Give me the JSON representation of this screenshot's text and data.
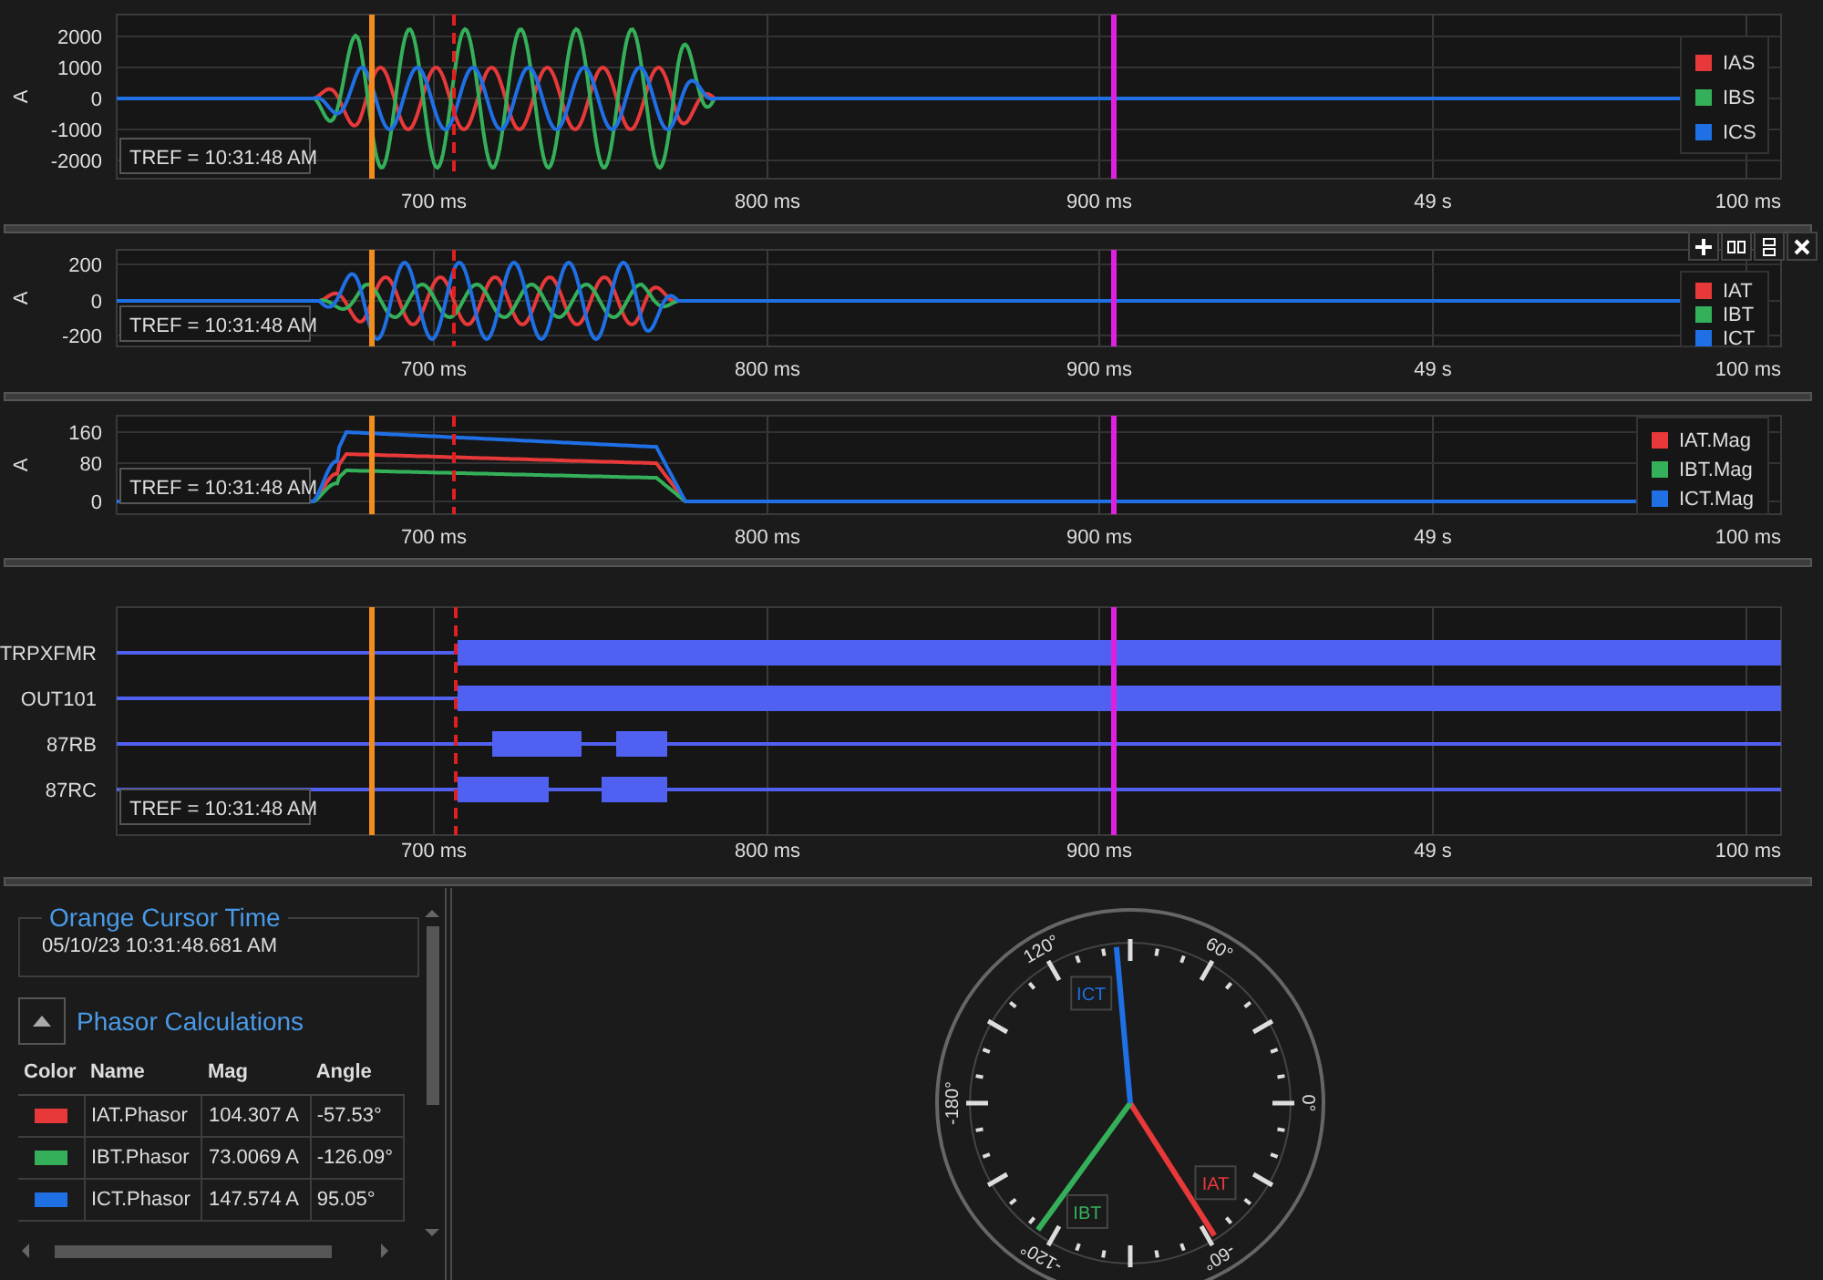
{
  "waveform_panels": [
    {
      "kind": "sampled",
      "y_axis_label": "A",
      "y_ticks": [
        "2000",
        "1000",
        "0",
        "-1000",
        "-2000"
      ],
      "x_ticks": [
        "700 ms",
        "800 ms",
        "900 ms",
        "49 s",
        "100 ms"
      ],
      "time_reference": "TREF = 10:31:48 AM",
      "toolbar_shown": false,
      "legend": [
        {
          "label": "IAS",
          "color": "#e8393a"
        },
        {
          "label": "IBS",
          "color": "#35b05a"
        },
        {
          "label": "ICS",
          "color": "#1f6fe5"
        }
      ]
    },
    {
      "kind": "sampled",
      "y_axis_label": "A",
      "y_ticks": [
        "200",
        "0",
        "-200"
      ],
      "x_ticks": [
        "700 ms",
        "800 ms",
        "900 ms",
        "49 s",
        "100 ms"
      ],
      "time_reference": "TREF = 10:31:48 AM",
      "toolbar_shown": true,
      "legend": [
        {
          "label": "IAT",
          "color": "#e8393a"
        },
        {
          "label": "IBT",
          "color": "#35b05a"
        },
        {
          "label": "ICT",
          "color": "#1f6fe5"
        }
      ]
    },
    {
      "kind": "magnitude",
      "y_axis_label": "A",
      "y_ticks": [
        "160",
        "80",
        "0"
      ],
      "x_ticks": [
        "700 ms",
        "800 ms",
        "900 ms",
        "49 s",
        "100 ms"
      ],
      "time_reference": "TREF = 10:31:48 AM",
      "toolbar_shown": false,
      "legend": [
        {
          "label": "IAT.Mag",
          "color": "#e8393a"
        },
        {
          "label": "IBT.Mag",
          "color": "#35b05a"
        },
        {
          "label": "ICT.Mag",
          "color": "#1f6fe5"
        }
      ]
    }
  ],
  "digital_panel": {
    "channels": [
      {
        "name": "TRPXFMR"
      },
      {
        "name": "OUT101"
      },
      {
        "name": "87RB"
      },
      {
        "name": "87RC"
      }
    ],
    "x_ticks": [
      "700 ms",
      "800 ms",
      "900 ms",
      "49 s",
      "100 ms"
    ],
    "time_reference": "TREF = 10:31:48 AM"
  },
  "cursor_time": {
    "title": "Orange Cursor Time",
    "value": "05/10/23 10:31:48.681 AM"
  },
  "phasor_calculations": {
    "title": "Phasor Calculations",
    "expanded": true,
    "columns": [
      "Color",
      "Name",
      "Mag",
      "Angle"
    ],
    "rows": [
      {
        "color": "#e8393a",
        "name": "IAT.Phasor",
        "mag": "104.307 A",
        "angle": "-57.53°"
      },
      {
        "color": "#35b05a",
        "name": "IBT.Phasor",
        "mag": "73.0069 A",
        "angle": "-126.09°"
      },
      {
        "color": "#1f6fe5",
        "name": "ICT.Phasor",
        "mag": "147.574 A",
        "angle": "95.05°"
      }
    ]
  },
  "phasor_diagram": {
    "angle_labels": [
      "120°",
      "60°",
      "0°",
      "-60°",
      "-120°",
      "-180°"
    ],
    "vectors": [
      {
        "label": "IAT",
        "color": "#e8393a"
      },
      {
        "label": "IBT",
        "color": "#35b05a"
      },
      {
        "label": "ICT",
        "color": "#1f6fe5"
      }
    ]
  }
}
